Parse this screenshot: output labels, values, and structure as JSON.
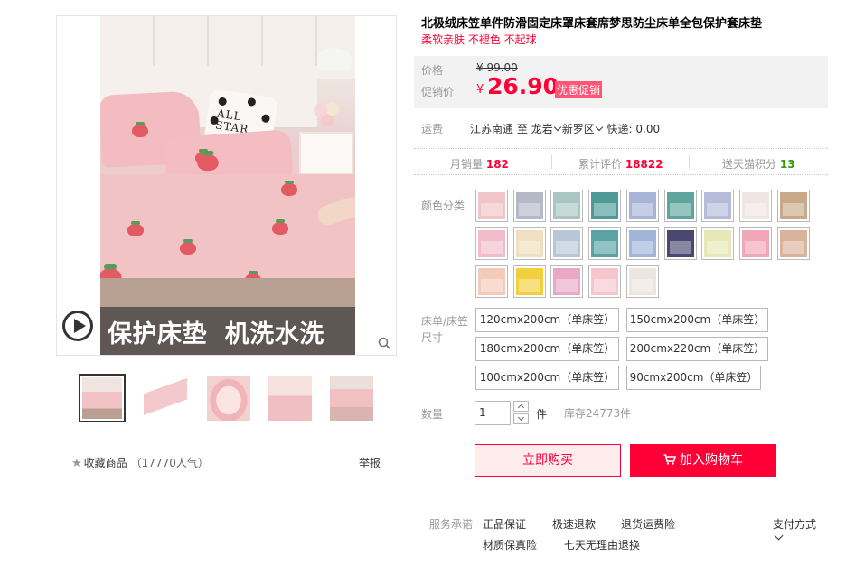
{
  "gallery": {
    "caption": "保护床垫  机洗水洗",
    "pillow_text": "ALL\nSTAR",
    "thumb_count": 5
  },
  "collect": {
    "label": "收藏商品",
    "count": "（17770人气）"
  },
  "report": "举报",
  "product": {
    "title": "北极绒床笠单件防滑固定床罩床套席梦思防尘床单全包保护套床垫",
    "subtitle": "柔软亲肤 不褪色 不起球"
  },
  "price": {
    "label_price": "价格",
    "old_price": "¥ 99.00",
    "label_promo": "促销价",
    "currency": "¥",
    "current": "26.90",
    "badge": "优惠促销"
  },
  "shipping": {
    "label": "运费",
    "from": "江苏南通",
    "to": "至",
    "city": "龙岩",
    "district": "新罗区",
    "express": "快递: 0.00"
  },
  "stats": {
    "monthly_label": "月销量",
    "monthly": "182",
    "reviews_label": "累计评价",
    "reviews": "18822",
    "points_label": "送天猫积分",
    "points": "13"
  },
  "colors": {
    "label": "颜色分类",
    "swatches": [
      "#f1c4c8",
      "#b4b8c7",
      "#a9c6c4",
      "#4d9a96",
      "#a7b4d6",
      "#5fa59d",
      "#b6bcd8",
      "#efe6e4",
      "#c9a989",
      "#f2bccb",
      "#f0dfc0",
      "#b8c7d8",
      "#5aa2a4",
      "#9fb6d9",
      "#4a4770",
      "#e7e8b6",
      "#f2a7b9",
      "#d9b39a",
      "#f4cab8",
      "#f1cf3d",
      "#e8a8c6",
      "#f6c6cf",
      "#ede5df"
    ]
  },
  "sizes": {
    "label_line1": "床单/床笠",
    "label_line2": "尺寸",
    "options": [
      "120cmx200cm（单床笠）",
      "150cmx200cm（单床笠）",
      "180cmx200cm（单床笠）",
      "200cmx220cm（单床笠）",
      "100cmx200cm（单床笠）",
      "90cmx200cm（单床笠）"
    ]
  },
  "quantity": {
    "label": "数量",
    "value": "1",
    "unit": "件",
    "stock": "库存24773件"
  },
  "buttons": {
    "buy": "立即购买",
    "cart": "加入购物车"
  },
  "services": {
    "label": "服务承诺",
    "items": [
      "正品保证",
      "极速退款",
      "退货运费险",
      "材质保真险",
      "七天无理由退换"
    ],
    "payment": "支付方式"
  },
  "colors_theme": {
    "accent": "#ff0036"
  }
}
